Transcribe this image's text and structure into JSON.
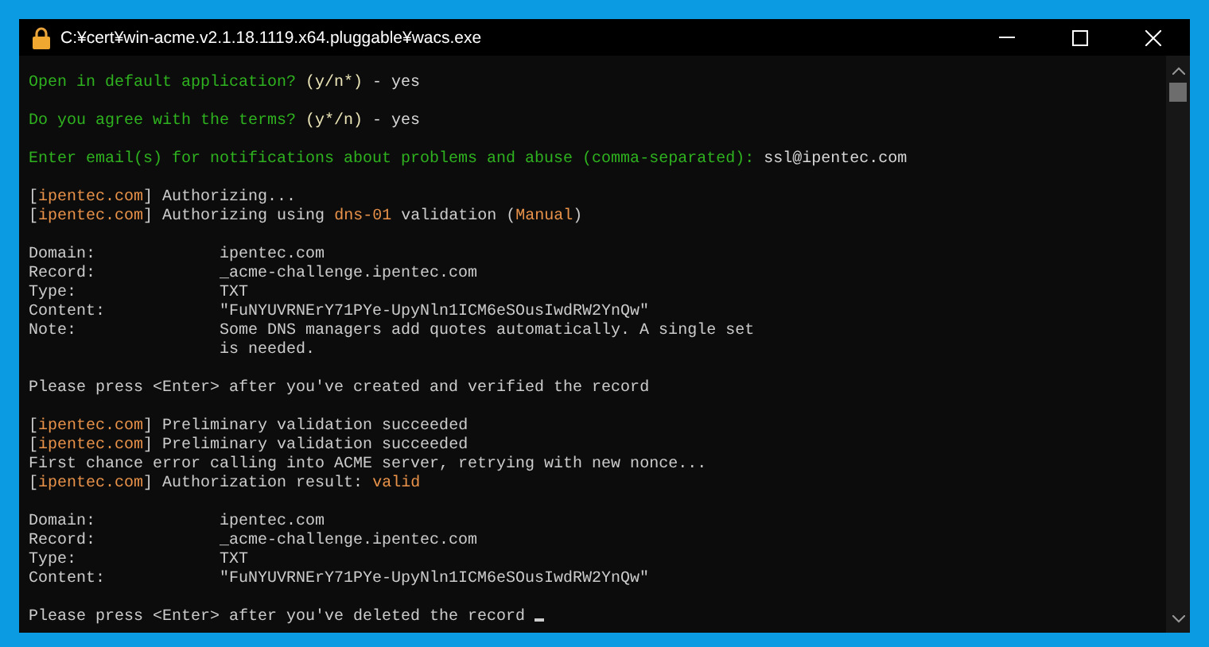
{
  "window": {
    "title": "C:¥cert¥win-acme.v2.1.18.1119.x64.pluggable¥wacs.exe"
  },
  "console": {
    "blocks": [
      {
        "lines": [
          {
            "kind": "text",
            "segments": [
              {
                "kind": "prompt",
                "text": "Open in default application? "
              },
              {
                "kind": "option",
                "text": "(y/n*)"
              },
              {
                "kind": "answer",
                "text": " - yes"
              }
            ]
          }
        ]
      },
      {
        "lines": [
          {
            "kind": "text",
            "segments": [
              {
                "kind": "prompt",
                "text": "Do you agree with the terms? "
              },
              {
                "kind": "option",
                "text": "(y*/n)"
              },
              {
                "kind": "answer",
                "text": " - yes"
              }
            ]
          }
        ]
      },
      {
        "lines": [
          {
            "kind": "text",
            "segments": [
              {
                "kind": "prompt",
                "text": "Enter email(s) for notifications about problems and abuse (comma-separated): "
              },
              {
                "kind": "answer",
                "text": "ssl@ipentec.com"
              }
            ]
          }
        ]
      },
      {
        "lines": [
          {
            "kind": "text",
            "segments": [
              {
                "kind": "plain",
                "text": "["
              },
              {
                "kind": "accent",
                "text": "ipentec.com"
              },
              {
                "kind": "plain",
                "text": "] Authorizing..."
              }
            ]
          },
          {
            "kind": "text",
            "segments": [
              {
                "kind": "plain",
                "text": "["
              },
              {
                "kind": "accent",
                "text": "ipentec.com"
              },
              {
                "kind": "plain",
                "text": "] Authorizing using "
              },
              {
                "kind": "accent",
                "text": "dns-01"
              },
              {
                "kind": "plain",
                "text": " validation ("
              },
              {
                "kind": "accent",
                "text": "Manual"
              },
              {
                "kind": "plain",
                "text": ")"
              }
            ]
          }
        ]
      },
      {
        "lines": [
          {
            "kind": "field",
            "label": "Domain:",
            "value": "ipentec.com"
          },
          {
            "kind": "field",
            "label": "Record:",
            "value": "_acme-challenge.ipentec.com"
          },
          {
            "kind": "field",
            "label": "Type:",
            "value": "TXT"
          },
          {
            "kind": "field",
            "label": "Content:",
            "value": "\"FuNYUVRNErY71PYe-UpyNln1ICM6eSOusIwdRW2YnQw\""
          },
          {
            "kind": "field",
            "label": "Note:",
            "value": "Some DNS managers add quotes automatically. A single set is needed."
          }
        ]
      },
      {
        "lines": [
          {
            "kind": "text",
            "segments": [
              {
                "kind": "plain",
                "text": "Please press <Enter> after you've created and verified the record"
              }
            ]
          }
        ]
      },
      {
        "lines": [
          {
            "kind": "text",
            "segments": [
              {
                "kind": "plain",
                "text": "["
              },
              {
                "kind": "accent",
                "text": "ipentec.com"
              },
              {
                "kind": "plain",
                "text": "] Preliminary validation succeeded"
              }
            ]
          },
          {
            "kind": "text",
            "segments": [
              {
                "kind": "plain",
                "text": "["
              },
              {
                "kind": "accent",
                "text": "ipentec.com"
              },
              {
                "kind": "plain",
                "text": "] Preliminary validation succeeded"
              }
            ]
          },
          {
            "kind": "text",
            "segments": [
              {
                "kind": "plain",
                "text": "First chance error calling into ACME server, retrying with new nonce..."
              }
            ]
          },
          {
            "kind": "text",
            "segments": [
              {
                "kind": "plain",
                "text": "["
              },
              {
                "kind": "accent",
                "text": "ipentec.com"
              },
              {
                "kind": "plain",
                "text": "] Authorization result: "
              },
              {
                "kind": "accent",
                "text": "valid"
              }
            ]
          }
        ]
      },
      {
        "lines": [
          {
            "kind": "field",
            "label": "Domain:",
            "value": "ipentec.com"
          },
          {
            "kind": "field",
            "label": "Record:",
            "value": "_acme-challenge.ipentec.com"
          },
          {
            "kind": "field",
            "label": "Type:",
            "value": "TXT"
          },
          {
            "kind": "field",
            "label": "Content:",
            "value": "\"FuNYUVRNErY71PYe-UpyNln1ICM6eSOusIwdRW2YnQw\""
          }
        ]
      },
      {
        "lines": [
          {
            "kind": "text",
            "segments": [
              {
                "kind": "plain",
                "text": "Please press <Enter> after you've deleted the record "
              }
            ]
          }
        ]
      }
    ]
  }
}
